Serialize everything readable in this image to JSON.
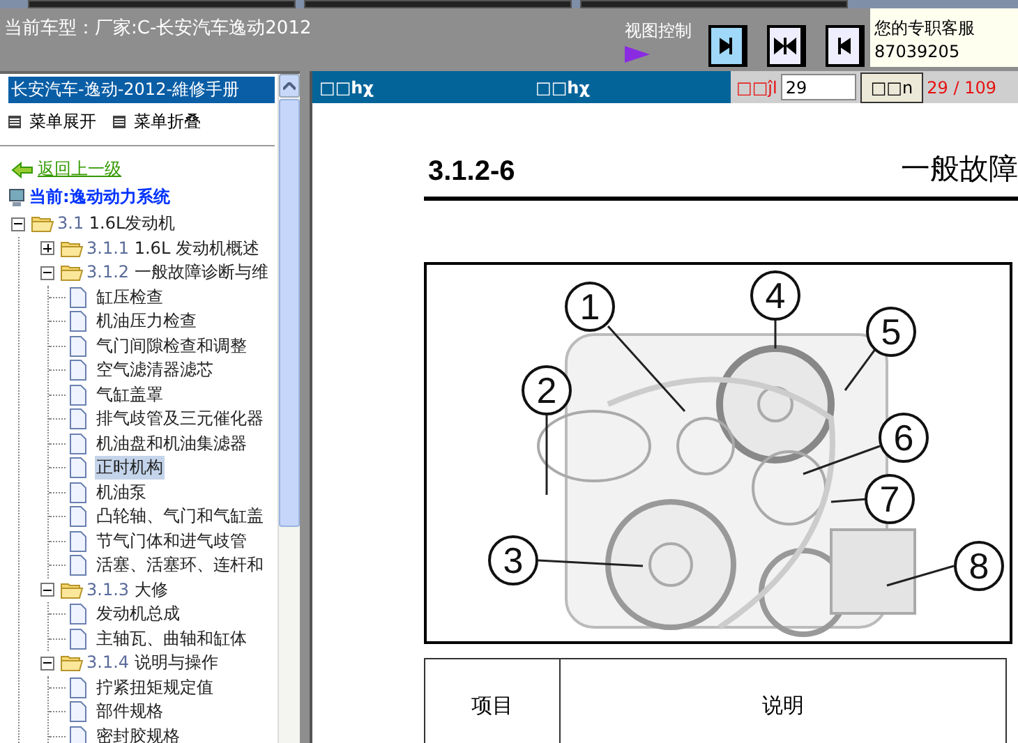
{
  "header": {
    "vehicle": "当前车型：厂家:C-长安汽车逸动2012",
    "view_control": "视图控制",
    "service_title": "您的专职客服",
    "service_phone": "87039205"
  },
  "sidebar": {
    "title": "长安汽车-逸动-2012-維修手册",
    "expand": "菜单展开",
    "collapse": "菜单折叠",
    "back": "返回上一级",
    "current": "当前:逸动动力系统",
    "tree": [
      {
        "kind": "folder",
        "number": "3.1",
        "label": "1.6L发动机",
        "expanded": true,
        "selected": false,
        "children": [
          {
            "kind": "folder",
            "number": "3.1.1",
            "label": "1.6L 发动机概述",
            "expanded": false,
            "selected": false
          },
          {
            "kind": "folder",
            "number": "3.1.2",
            "label": "一般故障诊断与维",
            "expanded": true,
            "selected": false,
            "children": [
              {
                "kind": "page",
                "label": "缸压检查",
                "selected": false
              },
              {
                "kind": "page",
                "label": "机油压力检查",
                "selected": false
              },
              {
                "kind": "page",
                "label": "气门间隙检查和调整",
                "selected": false
              },
              {
                "kind": "page",
                "label": "空气滤清器滤芯",
                "selected": false
              },
              {
                "kind": "page",
                "label": "气缸盖罩",
                "selected": false
              },
              {
                "kind": "page",
                "label": "排气歧管及三元催化器",
                "selected": false
              },
              {
                "kind": "page",
                "label": "机油盘和机油集滤器",
                "selected": false
              },
              {
                "kind": "page",
                "label": "正时机构",
                "selected": true
              },
              {
                "kind": "page",
                "label": "机油泵",
                "selected": false
              },
              {
                "kind": "page",
                "label": "凸轮轴、气门和气缸盖",
                "selected": false
              },
              {
                "kind": "page",
                "label": "节气门体和进气歧管",
                "selected": false
              },
              {
                "kind": "page",
                "label": "活塞、活塞环、连杆和",
                "selected": false
              }
            ]
          },
          {
            "kind": "folder",
            "number": "3.1.3",
            "label": "大修",
            "expanded": true,
            "selected": false,
            "children": [
              {
                "kind": "page",
                "label": "发动机总成",
                "selected": false
              },
              {
                "kind": "page",
                "label": "主轴瓦、曲轴和缸体",
                "selected": false
              }
            ]
          },
          {
            "kind": "folder",
            "number": "3.1.4",
            "label": "说明与操作",
            "expanded": true,
            "selected": false,
            "children": [
              {
                "kind": "page",
                "label": "拧紧扭矩规定值",
                "selected": false
              },
              {
                "kind": "page",
                "label": "部件规格",
                "selected": false
              },
              {
                "kind": "page",
                "label": "密封胶规格",
                "selected": false
              }
            ]
          }
        ]
      }
    ]
  },
  "viewer": {
    "label_left": "□□hχ",
    "label_middle": "□□hχ",
    "page_label": "□□ĵl",
    "page_value": "29",
    "go_button": "□□n",
    "page_count": "29 / 109"
  },
  "document": {
    "section": "3.1.2-6",
    "heading": "一般故障",
    "callouts": [
      "1",
      "2",
      "3",
      "4",
      "5",
      "6",
      "7",
      "8"
    ],
    "table_header": [
      "项目",
      "说明"
    ]
  }
}
